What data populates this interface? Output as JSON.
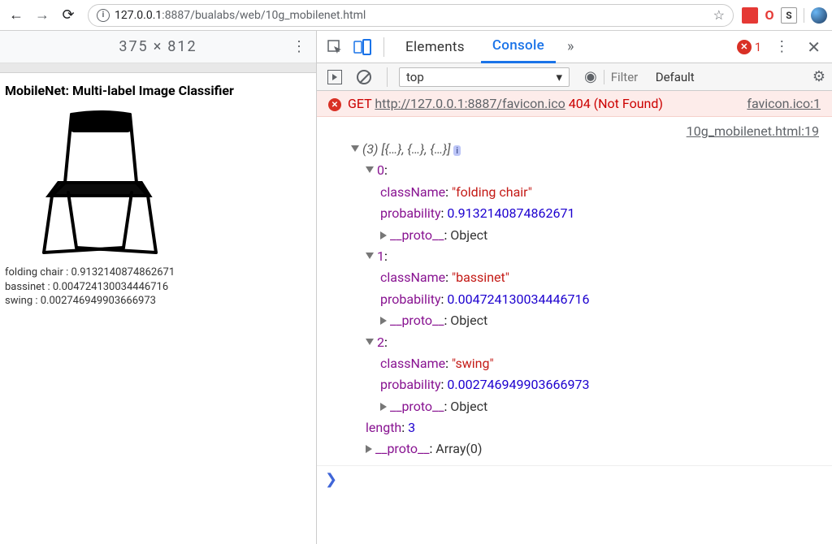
{
  "browser": {
    "url_host": "127.0.0.1",
    "url_port": ":8887",
    "url_path": "/bualabs/web/10g_mobilenet.html"
  },
  "device": {
    "width": "375",
    "sep": "×",
    "height": "812"
  },
  "page": {
    "title": "MobileNet: Multi-label Image Classifier",
    "predictions": [
      {
        "label": "folding chair",
        "prob": "0.9132140874862671"
      },
      {
        "label": "bassinet",
        "prob": "0.004724130034446716"
      },
      {
        "label": "swing",
        "prob": "0.002746949903666973"
      }
    ]
  },
  "devtools": {
    "tabs": {
      "elements": "Elements",
      "console": "Console"
    },
    "error_count": "1",
    "context": "top",
    "filter_placeholder": "Filter",
    "level": "Default",
    "error": {
      "method": "GET",
      "url": "http://127.0.0.1:8887/favicon.ico",
      "status": "404 (Not Found)",
      "source": "favicon.ico:1"
    },
    "log": {
      "source": "10g_mobilenet.html:19",
      "summary": "(3) [{…}, {…}, {…}]",
      "length_label": "length",
      "length_val": "3",
      "proto_label": "__proto__",
      "proto_obj": "Object",
      "proto_arr": "Array(0)",
      "className_label": "className",
      "probability_label": "probability",
      "items": [
        {
          "idx": "0",
          "className": "folding chair",
          "probability": "0.9132140874862671"
        },
        {
          "idx": "1",
          "className": "bassinet",
          "probability": "0.004724130034446716"
        },
        {
          "idx": "2",
          "className": "swing",
          "probability": "0.002746949903666973"
        }
      ]
    }
  }
}
